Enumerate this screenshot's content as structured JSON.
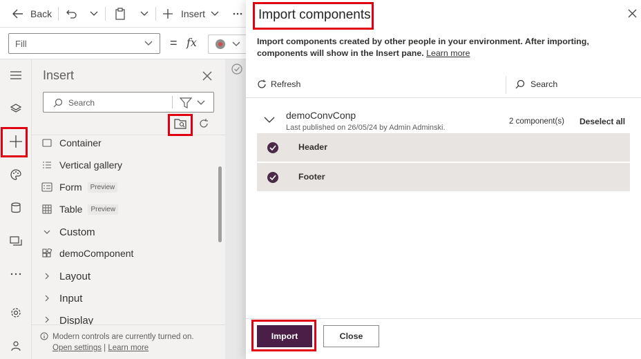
{
  "toolbar": {
    "back_label": "Back",
    "insert_label": "Insert"
  },
  "formula": {
    "property_value": "Fill",
    "equals": "=",
    "fx": "fx"
  },
  "insert_pane": {
    "title": "Insert",
    "search_placeholder": "Search",
    "items": [
      {
        "label": "Container",
        "icon": "container-icon"
      },
      {
        "label": "Vertical gallery",
        "icon": "gallery-icon"
      },
      {
        "label": "Form",
        "badge": "Preview",
        "icon": "form-icon"
      },
      {
        "label": "Table",
        "badge": "Preview",
        "icon": "table-icon"
      }
    ],
    "custom_group": "Custom",
    "custom_items": [
      {
        "label": "demoComponent",
        "icon": "component-icon"
      }
    ],
    "groups": [
      "Layout",
      "Input",
      "Display"
    ],
    "notice_text": "Modern controls are currently turned on.",
    "notice_link1": "Open settings",
    "notice_sep": "|",
    "notice_link2": "Learn more"
  },
  "dialog": {
    "title": "Import components",
    "description": "Import components created by other people in your environment. After importing, components will show in the Insert pane.",
    "learn_more": "Learn more",
    "refresh_label": "Refresh",
    "search_label": "Search",
    "library": {
      "name": "demoConvConp",
      "meta": "Last published on 26/05/24 by Admin Adminski.",
      "count": "2 component(s)",
      "deselect_all": "Deselect all",
      "components": [
        {
          "label": "Header",
          "checked": true
        },
        {
          "label": "Footer",
          "checked": true
        }
      ]
    },
    "import_button": "Import",
    "close_button": "Close"
  },
  "colors": {
    "accent": "#4b1e48",
    "highlight": "#e00012"
  }
}
